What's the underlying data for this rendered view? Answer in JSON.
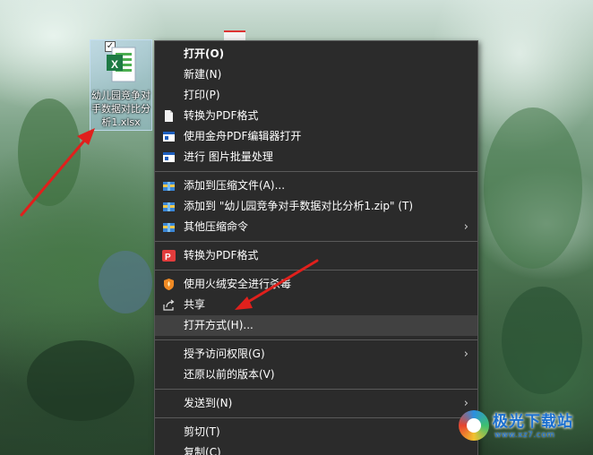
{
  "desktop": {
    "file_icon": {
      "label": "幼儿园竞争对手数据对比分析1.xlsx",
      "badge": "X",
      "checkbox": "✓"
    }
  },
  "menu": {
    "groups": [
      [
        {
          "label": "打开(O)",
          "icon": "none",
          "submenu": false,
          "bold": true
        },
        {
          "label": "新建(N)",
          "icon": "none",
          "submenu": false
        },
        {
          "label": "打印(P)",
          "icon": "none",
          "submenu": false
        },
        {
          "label": "转换为PDF格式",
          "icon": "document-icon",
          "submenu": false
        },
        {
          "label": "使用金舟PDF编辑器打开",
          "icon": "pdf-editor-icon",
          "submenu": false
        },
        {
          "label": "进行 图片批量处理",
          "icon": "image-batch-icon",
          "submenu": false
        }
      ],
      [
        {
          "label": "添加到压缩文件(A)...",
          "icon": "archive-icon",
          "submenu": false
        },
        {
          "label": "添加到 \"幼儿园竞争对手数据对比分析1.zip\" (T)",
          "icon": "archive-icon",
          "submenu": false
        },
        {
          "label": "其他压缩命令",
          "icon": "archive-icon",
          "submenu": true
        }
      ],
      [
        {
          "label": "转换为PDF格式",
          "icon": "pdf-convert-icon",
          "submenu": false
        }
      ],
      [
        {
          "label": "使用火绒安全进行杀毒",
          "icon": "shield-icon",
          "submenu": false
        },
        {
          "label": "共享",
          "icon": "share-icon",
          "submenu": false
        },
        {
          "label": "打开方式(H)...",
          "icon": "none",
          "submenu": false,
          "highlighted": true
        }
      ],
      [
        {
          "label": "授予访问权限(G)",
          "icon": "none",
          "submenu": true
        },
        {
          "label": "还原以前的版本(V)",
          "icon": "none",
          "submenu": false
        }
      ],
      [
        {
          "label": "发送到(N)",
          "icon": "none",
          "submenu": true
        }
      ],
      [
        {
          "label": "剪切(T)",
          "icon": "none",
          "submenu": false
        },
        {
          "label": "复制(C)",
          "icon": "none",
          "submenu": false
        }
      ]
    ],
    "submenu_arrow": "›"
  },
  "watermark": {
    "title": "极光下载站",
    "subtitle": "www.xz7.com"
  },
  "colors": {
    "menu_bg": "#2b2b2b",
    "menu_highlight": "#414141",
    "annotation_red": "#e0201c"
  }
}
